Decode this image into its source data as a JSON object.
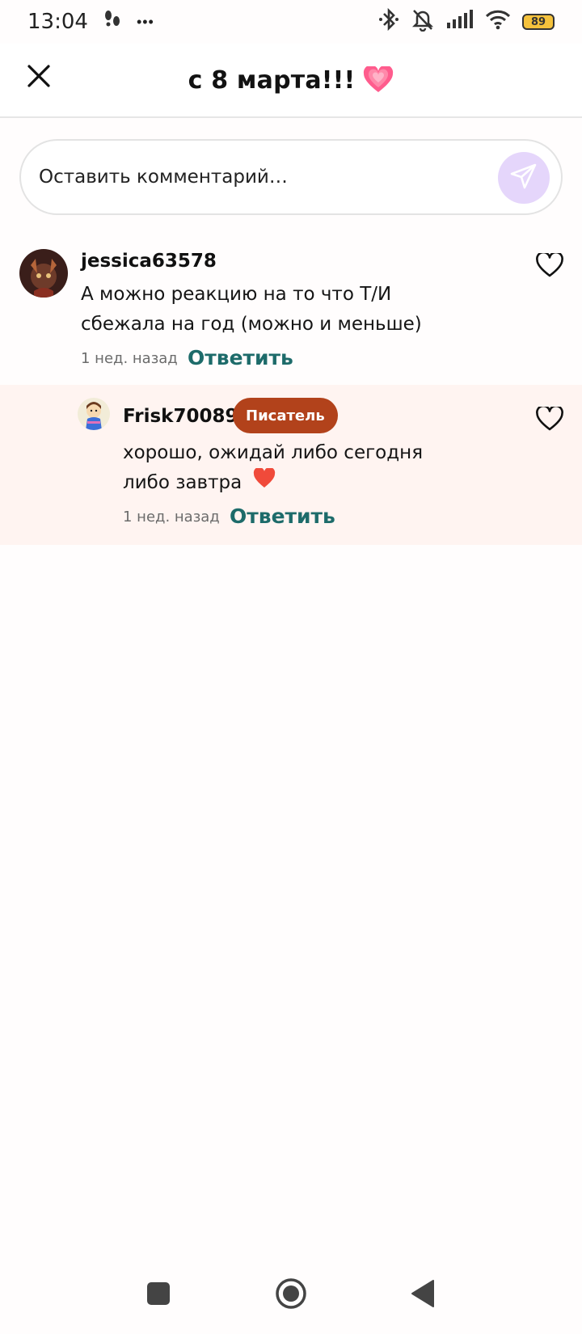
{
  "status_bar": {
    "time": "13:04",
    "more": "•••",
    "battery": "89",
    "icons": [
      "footprints-icon",
      "more-icon",
      "bluetooth-icon",
      "mute-bell-icon",
      "signal-icon",
      "wifi-icon",
      "battery-icon"
    ]
  },
  "header": {
    "title": "с 8 марта!!!",
    "emoji": "pink-heart-icon",
    "close_icon": "close-icon"
  },
  "comment_input": {
    "placeholder": "Оставить комментарий…",
    "send_icon": "send-icon"
  },
  "comments": [
    {
      "username": "jessica63578",
      "text": "А можно реакцию на то что Т/И сбежала на год (можно и меньше)",
      "time": "1 нед. назад",
      "reply_label": "Ответить"
    }
  ],
  "replies": [
    {
      "username": "Frisk70089",
      "badge": "Писатель",
      "text": "хорошо, ожидай либо сегодня либо завтра",
      "emoji": "red-heart-icon",
      "time": "1 нед. назад",
      "reply_label": "Ответить"
    }
  ],
  "colors": {
    "accent": "#1d6b6a",
    "badge": "#b2421b",
    "send_bg": "#e5d6fb",
    "reply_bg": "#fff4f1"
  }
}
